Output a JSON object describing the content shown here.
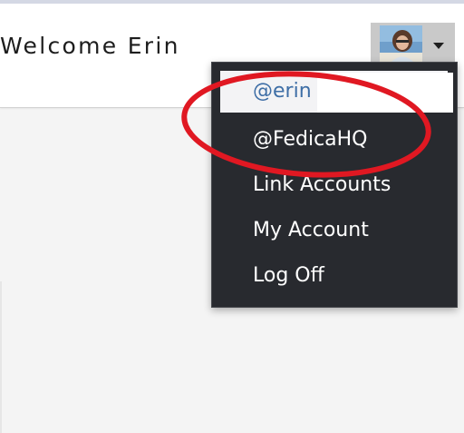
{
  "header": {
    "welcome_text": "Welcome Erin"
  },
  "account_menu": {
    "items": [
      {
        "label": "@erin",
        "active": true
      },
      {
        "label": "@FedicaHQ"
      },
      {
        "label": "Link Accounts"
      },
      {
        "label": "My Account"
      },
      {
        "label": "Log Off"
      }
    ]
  },
  "colors": {
    "menu_background": "#282a2f",
    "active_item_text": "#3e6ea6",
    "annotation_ellipse": "#e01822"
  },
  "icons": {
    "dropdown": "caret-down-icon"
  }
}
